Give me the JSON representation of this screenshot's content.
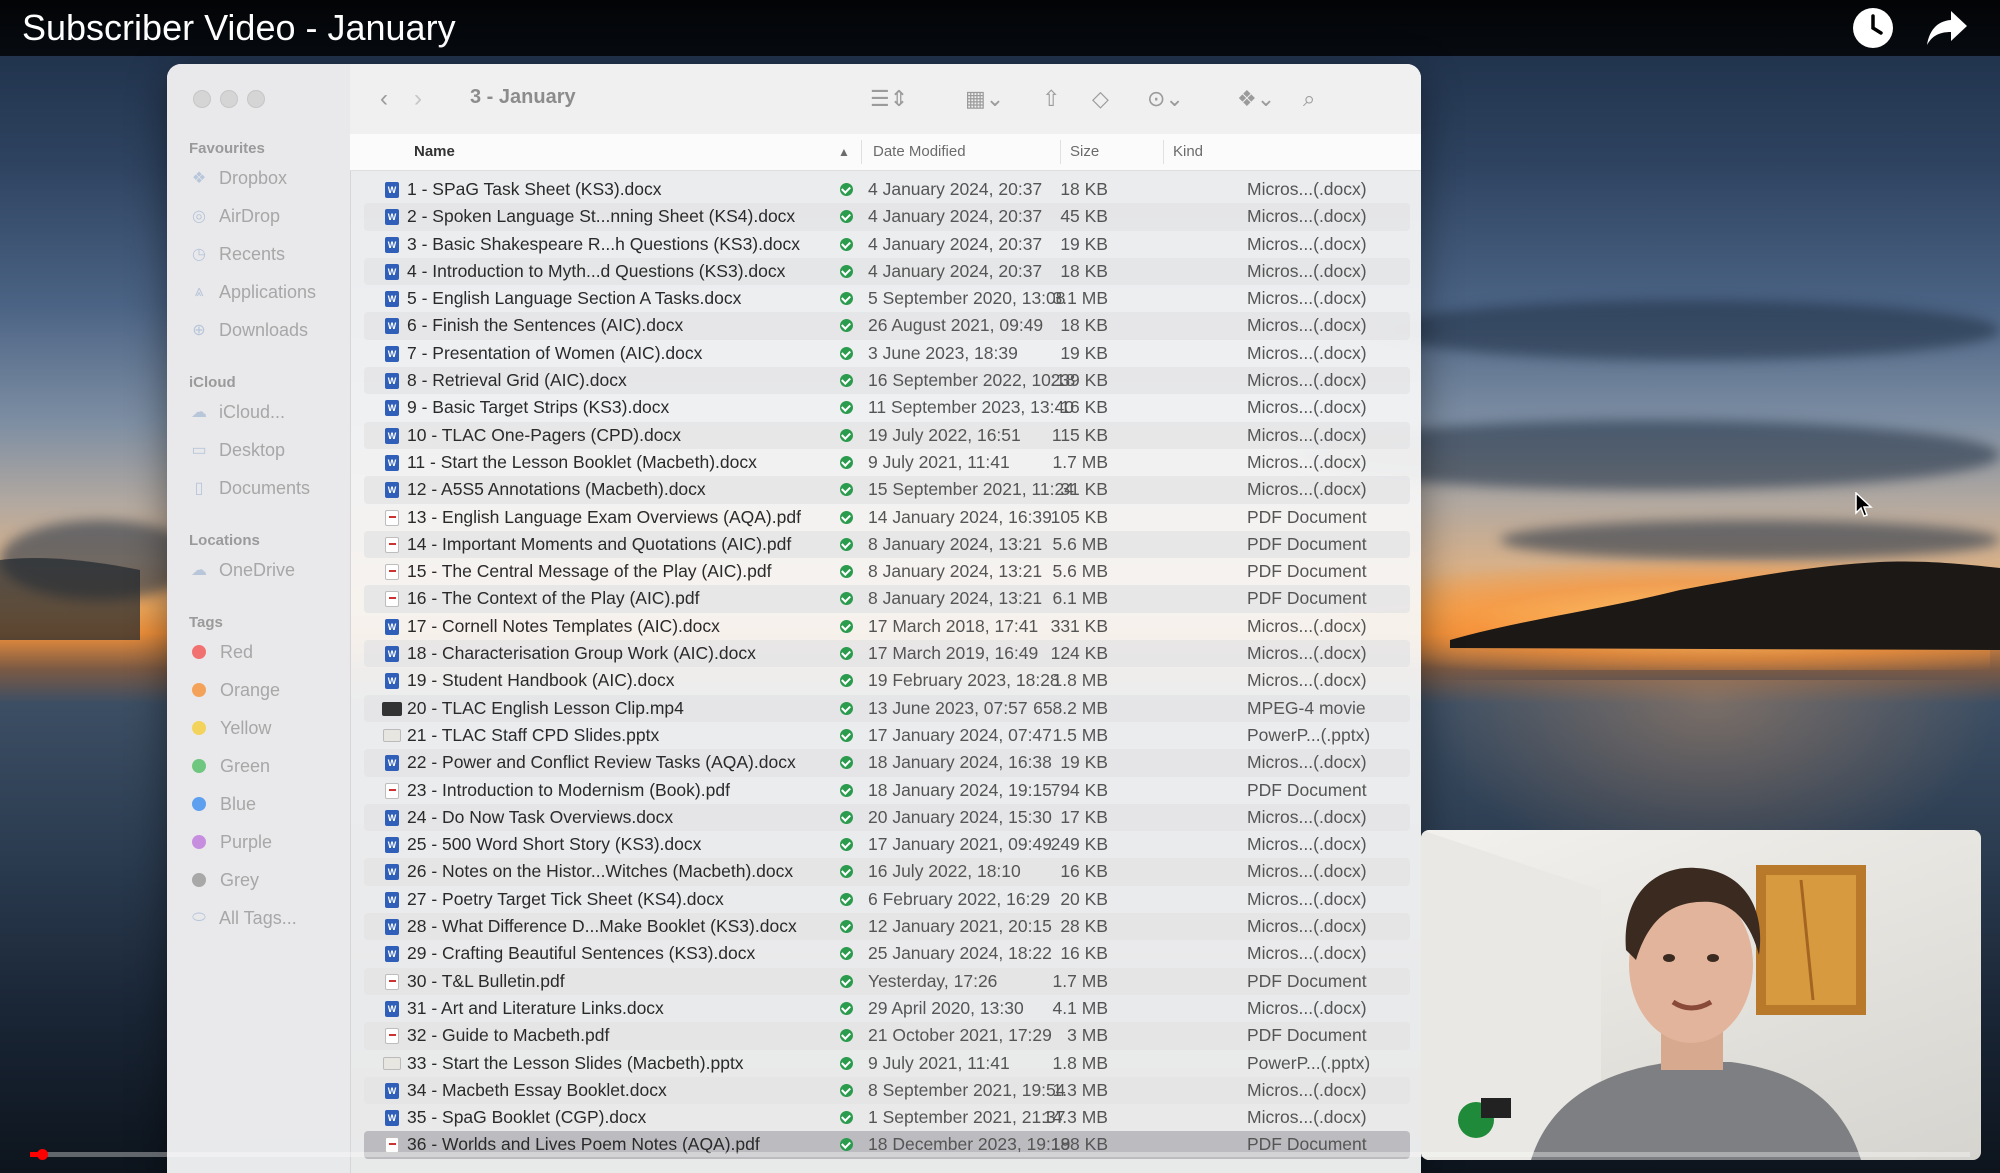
{
  "video": {
    "title": "Subscriber Video - January",
    "watch_later_icon": "clock-icon",
    "share_icon": "share-arrow-icon",
    "progress": 0.006
  },
  "finder": {
    "folder_title": "3 - January",
    "columns": {
      "name": "Name",
      "date": "Date Modified",
      "size": "Size",
      "kind": "Kind"
    },
    "sidebar": {
      "favourites_label": "Favourites",
      "favourites": [
        "Dropbox",
        "AirDrop",
        "Recents",
        "Applications",
        "Downloads"
      ],
      "icloud_label": "iCloud",
      "icloud": [
        "iCloud...",
        "Desktop",
        "Documents"
      ],
      "locations_label": "Locations",
      "locations": [
        "OneDrive"
      ],
      "tags_label": "Tags",
      "tags": [
        {
          "name": "Red",
          "color": "#f17171"
        },
        {
          "name": "Orange",
          "color": "#f4a25a"
        },
        {
          "name": "Yellow",
          "color": "#f3d35c"
        },
        {
          "name": "Green",
          "color": "#6fc77f"
        },
        {
          "name": "Blue",
          "color": "#5f9ff0"
        },
        {
          "name": "Purple",
          "color": "#c78ee0"
        },
        {
          "name": "Grey",
          "color": "#a8a8a8"
        }
      ],
      "all_tags": "All Tags..."
    },
    "files": [
      {
        "name": "1 - SPaG Task Sheet (KS3).docx",
        "date": "4 January 2024, 20:37",
        "size": "18 KB",
        "kind": "Micros...(.docx)",
        "type": "word"
      },
      {
        "name": "2 - Spoken Language St...nning Sheet (KS4).docx",
        "date": "4 January 2024, 20:37",
        "size": "45 KB",
        "kind": "Micros...(.docx)",
        "type": "word"
      },
      {
        "name": "3 - Basic Shakespeare R...h Questions (KS3).docx",
        "date": "4 January 2024, 20:37",
        "size": "19 KB",
        "kind": "Micros...(.docx)",
        "type": "word"
      },
      {
        "name": "4 - Introduction to Myth...d Questions (KS3).docx",
        "date": "4 January 2024, 20:37",
        "size": "18 KB",
        "kind": "Micros...(.docx)",
        "type": "word"
      },
      {
        "name": "5 - English Language Section A Tasks.docx",
        "date": "5 September 2020, 13:08",
        "size": "3.1 MB",
        "kind": "Micros...(.docx)",
        "type": "word"
      },
      {
        "name": "6 - Finish the Sentences (AIC).docx",
        "date": "26 August 2021, 09:49",
        "size": "18 KB",
        "kind": "Micros...(.docx)",
        "type": "word"
      },
      {
        "name": "7 - Presentation of Women (AIC).docx",
        "date": "3 June 2023, 18:39",
        "size": "19 KB",
        "kind": "Micros...(.docx)",
        "type": "word"
      },
      {
        "name": "8 - Retrieval Grid (AIC).docx",
        "date": "16 September 2022, 10:18",
        "size": "239 KB",
        "kind": "Micros...(.docx)",
        "type": "word"
      },
      {
        "name": "9 - Basic Target Strips (KS3).docx",
        "date": "11 September 2023, 13:40",
        "size": "16 KB",
        "kind": "Micros...(.docx)",
        "type": "word"
      },
      {
        "name": "10 - TLAC One-Pagers (CPD).docx",
        "date": "19 July 2022, 16:51",
        "size": "115 KB",
        "kind": "Micros...(.docx)",
        "type": "word"
      },
      {
        "name": "11 - Start the Lesson Booklet (Macbeth).docx",
        "date": "9 July 2021, 11:41",
        "size": "1.7 MB",
        "kind": "Micros...(.docx)",
        "type": "word"
      },
      {
        "name": "12 - A5S5 Annotations (Macbeth).docx",
        "date": "15 September 2021, 11:24",
        "size": "31 KB",
        "kind": "Micros...(.docx)",
        "type": "word"
      },
      {
        "name": "13 - English Language Exam Overviews (AQA).pdf",
        "date": "14 January 2024, 16:39",
        "size": "105 KB",
        "kind": "PDF Document",
        "type": "pdf"
      },
      {
        "name": "14 - Important Moments and Quotations (AIC).pdf",
        "date": "8 January 2024, 13:21",
        "size": "5.6 MB",
        "kind": "PDF Document",
        "type": "pdf"
      },
      {
        "name": "15 - The Central Message of the Play (AIC).pdf",
        "date": "8 January 2024, 13:21",
        "size": "5.6 MB",
        "kind": "PDF Document",
        "type": "pdf"
      },
      {
        "name": "16 - The Context of the Play (AIC).pdf",
        "date": "8 January 2024, 13:21",
        "size": "6.1 MB",
        "kind": "PDF Document",
        "type": "pdf"
      },
      {
        "name": "17 - Cornell Notes Templates (AIC).docx",
        "date": "17 March 2018, 17:41",
        "size": "331 KB",
        "kind": "Micros...(.docx)",
        "type": "word"
      },
      {
        "name": "18 - Characterisation Group Work (AIC).docx",
        "date": "17 March 2019, 16:49",
        "size": "124 KB",
        "kind": "Micros...(.docx)",
        "type": "word"
      },
      {
        "name": "19 - Student Handbook (AIC).docx",
        "date": "19 February 2023, 18:28",
        "size": "1.8 MB",
        "kind": "Micros...(.docx)",
        "type": "word"
      },
      {
        "name": "20 - TLAC English Lesson Clip.mp4",
        "date": "13 June 2023, 07:57",
        "size": "658.2 MB",
        "kind": "MPEG-4 movie",
        "type": "mp4"
      },
      {
        "name": "21 - TLAC Staff CPD Slides.pptx",
        "date": "17 January 2024, 07:47",
        "size": "1.5 MB",
        "kind": "PowerP...(.pptx)",
        "type": "pptx"
      },
      {
        "name": "22 - Power and Conflict Review Tasks (AQA).docx",
        "date": "18 January 2024, 16:38",
        "size": "19 KB",
        "kind": "Micros...(.docx)",
        "type": "word"
      },
      {
        "name": "23 - Introduction to Modernism (Book).pdf",
        "date": "18 January 2024, 19:15",
        "size": "794 KB",
        "kind": "PDF Document",
        "type": "pdf"
      },
      {
        "name": "24 - Do Now Task Overviews.docx",
        "date": "20 January 2024, 15:30",
        "size": "17 KB",
        "kind": "Micros...(.docx)",
        "type": "word"
      },
      {
        "name": "25 - 500 Word Short Story (KS3).docx",
        "date": "17 January 2021, 09:49",
        "size": "249 KB",
        "kind": "Micros...(.docx)",
        "type": "word"
      },
      {
        "name": "26 - Notes on the Histor...Witches (Macbeth).docx",
        "date": "16 July 2022, 18:10",
        "size": "16 KB",
        "kind": "Micros...(.docx)",
        "type": "word"
      },
      {
        "name": "27 - Poetry Target Tick Sheet (KS4).docx",
        "date": "6 February 2022, 16:29",
        "size": "20 KB",
        "kind": "Micros...(.docx)",
        "type": "word"
      },
      {
        "name": "28 - What Difference D...Make Booklet (KS3).docx",
        "date": "12 January 2021, 20:15",
        "size": "28 KB",
        "kind": "Micros...(.docx)",
        "type": "word"
      },
      {
        "name": "29 - Crafting Beautiful Sentences (KS3).docx",
        "date": "25 January 2024, 18:22",
        "size": "16 KB",
        "kind": "Micros...(.docx)",
        "type": "word"
      },
      {
        "name": "30 - T&L Bulletin.pdf",
        "date": "Yesterday, 17:26",
        "size": "1.7 MB",
        "kind": "PDF Document",
        "type": "pdf"
      },
      {
        "name": "31 - Art and Literature Links.docx",
        "date": "29 April 2020, 13:30",
        "size": "4.1 MB",
        "kind": "Micros...(.docx)",
        "type": "word"
      },
      {
        "name": "32 - Guide to Macbeth.pdf",
        "date": "21 October 2021, 17:29",
        "size": "3 MB",
        "kind": "PDF Document",
        "type": "pdf"
      },
      {
        "name": "33 - Start the Lesson Slides (Macbeth).pptx",
        "date": "9 July 2021, 11:41",
        "size": "1.8 MB",
        "kind": "PowerP...(.pptx)",
        "type": "pptx"
      },
      {
        "name": "34 - Macbeth Essay Booklet.docx",
        "date": "8 September 2021, 19:54",
        "size": "1.3 MB",
        "kind": "Micros...(.docx)",
        "type": "word"
      },
      {
        "name": "35 - SpaG Booklet (CGP).docx",
        "date": "1 September 2021, 21:37",
        "size": "14.3 MB",
        "kind": "Micros...(.docx)",
        "type": "word"
      },
      {
        "name": "36 - Worlds and Lives Poem Notes (AQA).pdf",
        "date": "18 December 2023, 19:19",
        "size": "188 KB",
        "kind": "PDF Document",
        "type": "pdf",
        "selected": true
      }
    ]
  }
}
